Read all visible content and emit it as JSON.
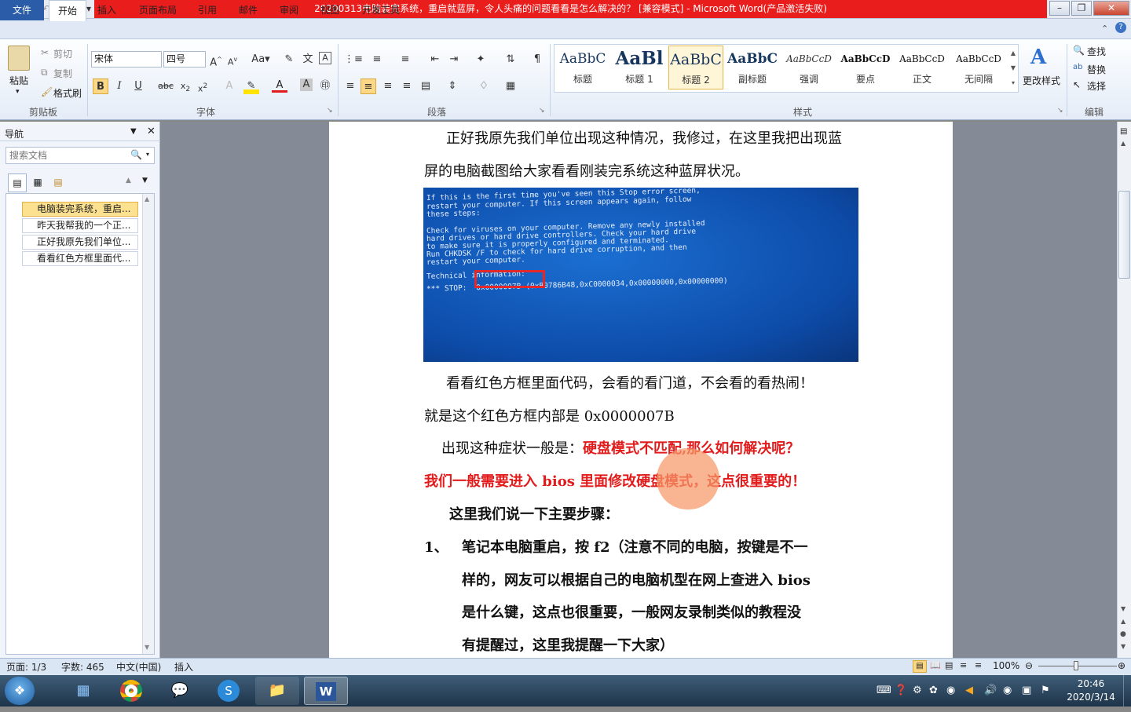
{
  "window": {
    "title": "20200313电脑装完系统，重启就蓝屏，令人头痛的问题看看是怎么解决的？ [兼容模式] - Microsoft Word(产品激活失败)"
  },
  "ribbon": {
    "tabs": [
      "文件",
      "开始",
      "插入",
      "页面布局",
      "引用",
      "邮件",
      "审阅",
      "视图",
      "开发工具"
    ],
    "clipboard": {
      "paste": "粘贴",
      "cut": "剪切",
      "copy": "复制",
      "format_painter": "格式刷",
      "group": "剪贴板"
    },
    "font": {
      "name": "宋体",
      "size": "四号",
      "group": "字体"
    },
    "paragraph": {
      "group": "段落"
    },
    "styles": {
      "group": "样式",
      "items": [
        {
          "preview": "AaBbC",
          "label": "标题"
        },
        {
          "preview": "AaBl",
          "label": "标题 1"
        },
        {
          "preview": "AaBbC",
          "label": "标题 2"
        },
        {
          "preview": "AaBbC",
          "label": "副标题"
        },
        {
          "preview": "AaBbCcD",
          "label": "强调"
        },
        {
          "preview": "AaBbCcD",
          "label": "要点"
        },
        {
          "preview": "AaBbCcD",
          "label": "正文"
        },
        {
          "preview": "AaBbCcD",
          "label": "无间隔"
        }
      ],
      "change_styles": "更改样式"
    },
    "editing": {
      "find": "查找",
      "replace": "替换",
      "select": "选择",
      "group": "编辑"
    }
  },
  "nav": {
    "title": "导航",
    "search_placeholder": "搜索文档",
    "items": [
      "电脑装完系统，重启...",
      "昨天我帮我的一个正...",
      "正好我原先我们单位...",
      "看看红色方框里面代..."
    ]
  },
  "document": {
    "line1": "正好我原先我们单位出现这种情况，我修过，在这里我把出现蓝",
    "line2": "屏的电脑截图给大家看看刚装完系统这种蓝屏状况。",
    "bsod": [
      "If this is the first time you've seen this Stop error screen,",
      "restart your computer. If this screen appears again, follow",
      "these steps:",
      "Check for viruses on your computer. Remove any newly installed",
      "hard drives or hard drive controllers. Check your hard drive",
      "to make sure it is properly configured and terminated.",
      "Run CHKDSK /F to check for hard drive corruption, and then",
      "restart your computer.",
      "Technical information:"
    ],
    "bsod_stop_prefix": "*** STOP:",
    "bsod_stop_code": "0x0000007B",
    "bsod_stop_params": "(0xB0786B48,0xC0000034,0x00000000,0x00000000)",
    "line3": "看看红色方框里面代码，会看的看门道，不会看的看热闹！",
    "line4": "就是这个红色方框内部是 0x0000007B",
    "line5_normal": "出现这种症状一般是：",
    "line5_red": "硬盘模式不匹配,那么如何解决呢？",
    "line6": "我们一般需要进入 bios 里面修改硬盘模式，这点很重要的！",
    "line7": "这里我们说一下主要步骤：",
    "step_num": "1、",
    "step1": [
      "笔记本电脑重启，按 f2（注意不同的电脑，按键是不一",
      "样的，网友可以根据自己的电脑机型在网上查进入 bios",
      "是什么键，这点也很重要，一般网友录制类似的教程没",
      "有提醒过，这里我提醒一下大家）"
    ]
  },
  "status": {
    "page": "页面: 1/3",
    "words": "字数: 465",
    "lang": "中文(中国)",
    "mode": "插入",
    "zoom": "100%"
  },
  "taskbar": {
    "time": "20:46",
    "date": "2020/3/14"
  }
}
